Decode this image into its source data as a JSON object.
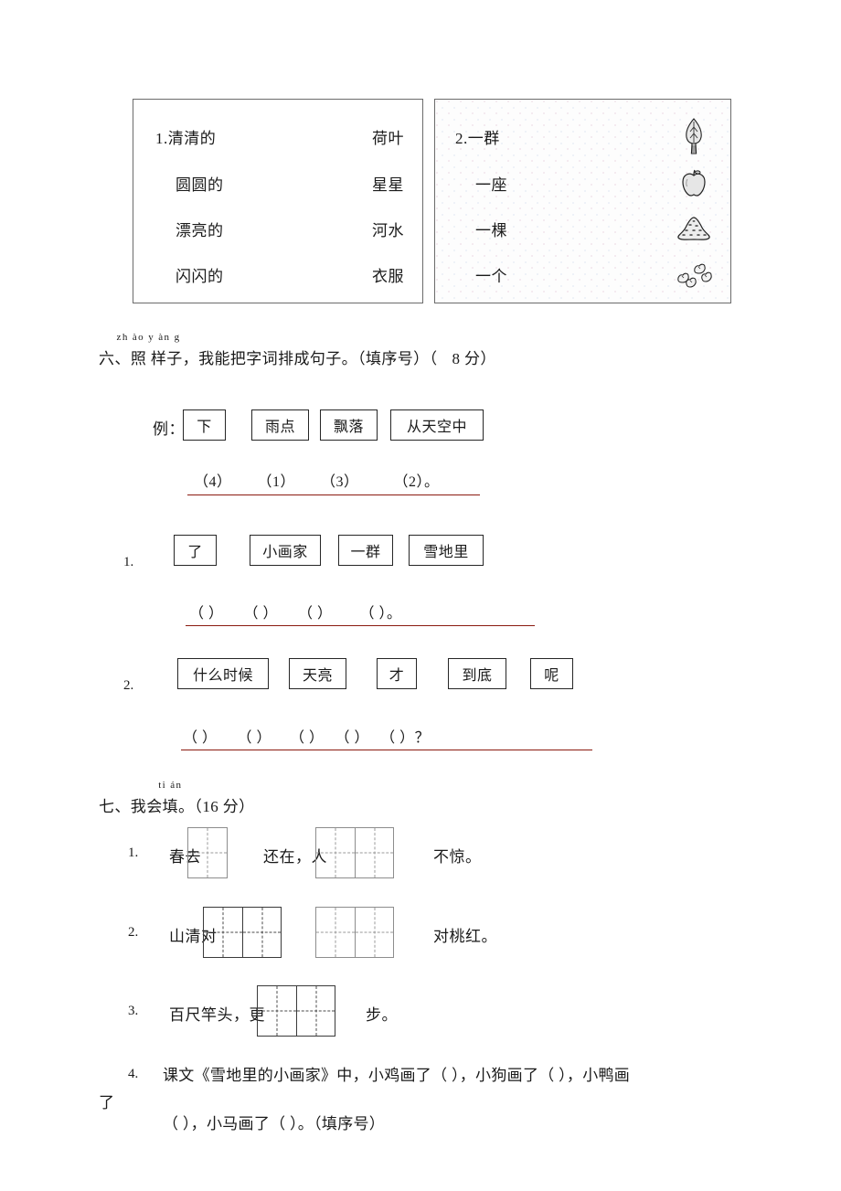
{
  "matching": {
    "box1": {
      "number_prefix": "1.",
      "rows": [
        {
          "left": "清清的",
          "right": "荷叶"
        },
        {
          "left": "圆圆的",
          "right": "星星"
        },
        {
          "left": "漂亮的",
          "right": "河水"
        },
        {
          "left": "闪闪的",
          "right": "衣服"
        }
      ]
    },
    "box2": {
      "number_prefix": "2.",
      "rows": [
        {
          "left": "一群",
          "icon": "tree-icon"
        },
        {
          "left": "一座",
          "icon": "apple-icon"
        },
        {
          "left": "一棵",
          "icon": "hill-icon"
        },
        {
          "left": "一个",
          "icon": "birds-icon"
        }
      ]
    }
  },
  "section6": {
    "number": "六、",
    "pinyin": "zh ào y àn g",
    "title_before": "照 样",
    "title_after": "子，我能把字词排成句子。（填序号）（",
    "score": "8 分",
    "score_close": "）",
    "example": {
      "label": "例：",
      "boxes": [
        "下",
        "雨点",
        "飘落",
        "从天空中"
      ],
      "answers": [
        "（4）",
        "（1）",
        "（3）",
        "（2）。"
      ]
    },
    "questions": [
      {
        "num": "1.",
        "boxes": [
          "了",
          "小画家",
          "一群",
          "雪地里"
        ],
        "answers": [
          "（    ）",
          "（    ）",
          "（    ）",
          "（    ）。"
        ]
      },
      {
        "num": "2.",
        "boxes": [
          "什么时候",
          "天亮",
          "才",
          "到底",
          "呢"
        ],
        "answers": [
          "（    ）",
          "（    ）",
          "（    ）",
          "（    ）",
          "（    ）？"
        ]
      }
    ]
  },
  "section7": {
    "number": "七、我会",
    "pinyin": "ti án",
    "title_char": "填",
    "title_after": "。（16 分）",
    "items": [
      {
        "num": "1.",
        "text_a": "春去",
        "grid_a_cells": 1,
        "text_b": "还在，人",
        "grid_b_cells": 2,
        "text_c": "不惊。"
      },
      {
        "num": "2.",
        "text_a": "山清对",
        "grid_a_cells": 2,
        "text_b": "",
        "grid_b_cells": 2,
        "text_c": "对桃红。"
      },
      {
        "num": "3.",
        "text_a": "百尺竿头，更",
        "grid_a_cells": 2,
        "text_b": "",
        "grid_b_cells": 0,
        "text_c": "步。"
      }
    ],
    "item4": {
      "num": "4.",
      "line1": "课文《雪地里的小画家》中，小鸡画了（        ），小狗画了（      ），小鸭画",
      "line2": "了",
      "line3": "（      ），小马画了（      ）。（填序号）"
    }
  },
  "colors": {
    "answer_underline": "#8b1a10",
    "box_border": "#6b6b6b",
    "grid_border": "#3a3a3a",
    "text": "#1a1a1a"
  }
}
